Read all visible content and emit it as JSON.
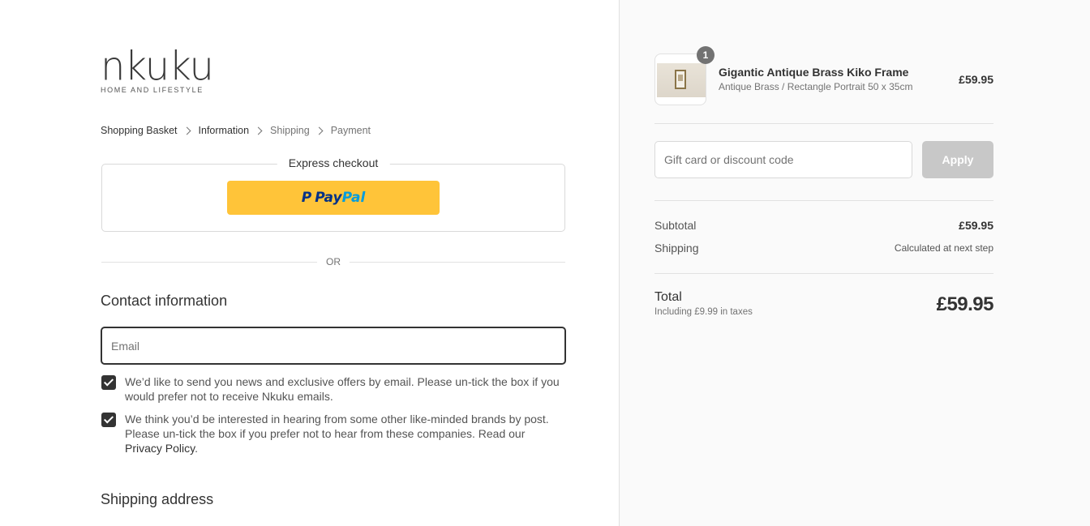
{
  "brand": {
    "wordmark": "nkuku",
    "tagline": "HOME AND LIFESTYLE"
  },
  "breadcrumb": [
    {
      "label": "Shopping Basket"
    },
    {
      "label": "Information"
    },
    {
      "label": "Shipping"
    },
    {
      "label": "Payment"
    }
  ],
  "express": {
    "title": "Express checkout",
    "paypal_pay": "Pay",
    "paypal_pal": "Pal",
    "paypal_mark": "P"
  },
  "divider_text": "OR",
  "contact": {
    "title": "Contact information",
    "email_placeholder": "Email",
    "email_value": "",
    "consent_email": "We’d like to send you news and exclusive offers by email. Please un-tick the box if you would prefer not to receive Nkuku emails.",
    "consent_post": "We think you’d be interested in hearing from some other like-minded brands by post. Please un-tick the box if you prefer not to hear from these companies. Read our",
    "policy_link": "Privacy Policy",
    "policy_end": "."
  },
  "shipping_address_title": "Shipping address",
  "order": {
    "item": {
      "quantity": "1",
      "name": "Gigantic Antique Brass Kiko Frame",
      "variant": "Antique Brass / Rectangle Portrait 50 x 35cm",
      "price": "£59.95"
    },
    "discount_placeholder": "Gift card or discount code",
    "apply_label": "Apply",
    "subtotal_label": "Subtotal",
    "subtotal_value": "£59.95",
    "shipping_label": "Shipping",
    "shipping_value": "Calculated at next step",
    "total_label": "Total",
    "total_tax_note": "Including £9.99 in taxes",
    "total_value": "£59.95"
  },
  "colors": {
    "paypal_yellow": "#ffc439",
    "paypal_blue": "#003087",
    "paypal_light_blue": "#009cde",
    "checkbox": "#333333",
    "sidebar_bg": "#fafafa",
    "apply_disabled": "#c8c8c8"
  }
}
